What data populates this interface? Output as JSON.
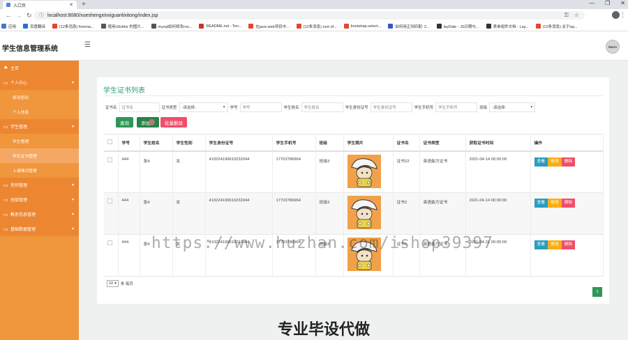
{
  "browser": {
    "tab_title": "入口页",
    "new_tab": "+",
    "url": "localhost:8080/xueshengxinxiguanlixitong/index.jsp",
    "bookmarks": [
      {
        "label": "应用",
        "color": "#4a76c9"
      },
      {
        "label": "百度翻译",
        "color": "#2a6cd4"
      },
      {
        "label": "(12条消息) freema...",
        "color": "#e0482e"
      },
      {
        "label": "使用UEditor 的图片...",
        "color": "#555555"
      },
      {
        "label": "mysql如何修改roo...",
        "color": "#555555"
      },
      {
        "label": "README.md - Ten...",
        "color": "#c0392b"
      },
      {
        "label": "在java web项目中...",
        "color": "#e0482e"
      },
      {
        "label": "(12条消息) root of...",
        "color": "#e0482e"
      },
      {
        "label": "bootstrap-select...",
        "color": "#e0482e"
      },
      {
        "label": "如何用正则匹配: 2...",
        "color": "#3a57c4"
      },
      {
        "label": "layDate - JS日期与...",
        "color": "#333333"
      },
      {
        "label": "表单组件文档 - Lay...",
        "color": "#333333"
      },
      {
        "label": "(12条消息) 关于lay...",
        "color": "#e0482e"
      }
    ]
  },
  "app": {
    "title": "学生信息管理系统",
    "avatar": "Mario"
  },
  "sidebar": [
    {
      "label": "主页",
      "level": "top",
      "icon": "⚑",
      "chevron": false
    },
    {
      "label": "个人中心",
      "level": "top",
      "icon": "▭",
      "chevron": true
    },
    {
      "label": "修改密码",
      "level": "sub"
    },
    {
      "label": "个人信息",
      "level": "sub"
    },
    {
      "label": "学生管理",
      "level": "top",
      "icon": "▭",
      "chevron": true
    },
    {
      "label": "学生管理",
      "level": "sub"
    },
    {
      "label": "学生证书管理",
      "level": "sub",
      "active": true
    },
    {
      "label": "上课情况管理",
      "level": "sub"
    },
    {
      "label": "老师管理",
      "level": "top",
      "icon": "▭",
      "chevron": true
    },
    {
      "label": "班级管理",
      "level": "top",
      "icon": "▭",
      "chevron": true
    },
    {
      "label": "教务信息管理",
      "level": "top",
      "icon": "▭",
      "chevron": true
    },
    {
      "label": "基础数据管理",
      "level": "top",
      "icon": "▭",
      "chevron": true
    }
  ],
  "main": {
    "title": "学生证书列表",
    "filters": [
      {
        "label": "证书名",
        "type": "input",
        "placeholder": "证书名",
        "width": 58
      },
      {
        "label": "证书类型",
        "type": "select",
        "value": "-请选择-",
        "width": 70
      },
      {
        "label": "学号",
        "type": "input",
        "placeholder": "学号",
        "width": 60
      },
      {
        "label": "学生姓名",
        "type": "input",
        "placeholder": "学生姓名",
        "width": 60
      },
      {
        "label": "学生身份证号",
        "type": "input",
        "placeholder": "学生身份证号",
        "width": 60
      },
      {
        "label": "学生手机号",
        "type": "input",
        "placeholder": "学生手机号",
        "width": 60
      },
      {
        "label": "班级",
        "type": "select",
        "value": "-请选择-",
        "width": 66
      }
    ],
    "buttons": {
      "search": "查询",
      "add": "添加",
      "batch_delete": "批量删除"
    },
    "columns": [
      "",
      "学号",
      "学生姓名",
      "学生性别",
      "学生身份证号",
      "学生手机号",
      "班级",
      "学生照片",
      "证书名",
      "证书类型",
      "获取证书时间",
      "操作"
    ],
    "rows": [
      {
        "student_no": "444",
        "name": "张4",
        "gender": "女",
        "id_card": "410224199610232044",
        "phone": "17703786964",
        "class": "班级3",
        "cert_name": "证书22",
        "cert_type": "英语能力证书",
        "time": "2021-04-14 00:00:00"
      },
      {
        "student_no": "444",
        "name": "张4",
        "gender": "女",
        "id_card": "410224199610232044",
        "phone": "17703786964",
        "class": "班级3",
        "cert_name": "证书2",
        "cert_type": "英语能力证书",
        "time": "2021-04-14 00:00:00"
      },
      {
        "student_no": "444",
        "name": "张4",
        "gender": "女",
        "id_card": "410224199610232044",
        "phone": "17703786964",
        "class": "班级3",
        "cert_name": "证书1",
        "cert_type": "英语能力证书",
        "time": "2021-04-21 00:00:00"
      }
    ],
    "actions": {
      "view": "查看",
      "edit": "修改",
      "delete": "删除"
    },
    "pager": {
      "size": "10",
      "per_page": "条 每页",
      "current": "1"
    }
  },
  "overlay": {
    "watermark": "https://www.huzhan.com/ishop39397",
    "promo": "专业毕设代做"
  }
}
